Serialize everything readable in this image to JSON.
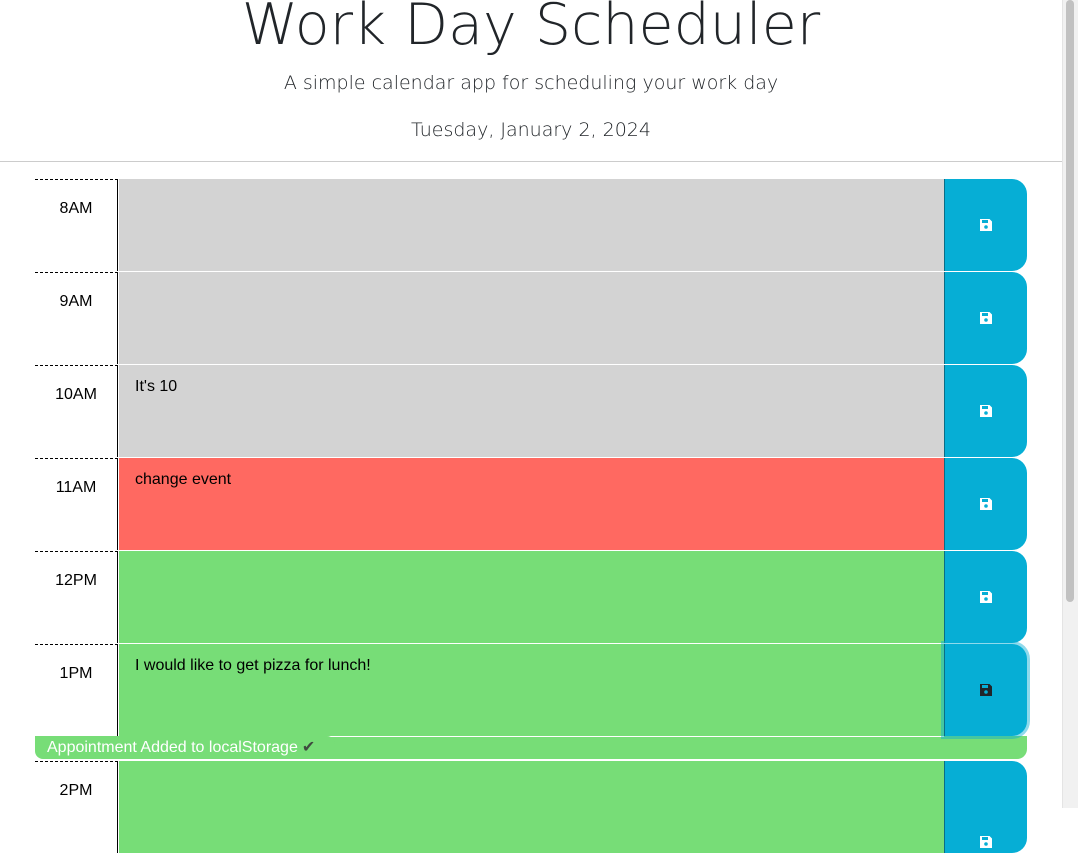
{
  "header": {
    "title": "Work Day Scheduler",
    "subtitle": "A simple calendar app for scheduling your work day",
    "current_day": "Tuesday, January 2, 2024"
  },
  "timeblocks": [
    {
      "hour": "8AM",
      "text": "",
      "state": "past"
    },
    {
      "hour": "9AM",
      "text": "",
      "state": "past"
    },
    {
      "hour": "10AM",
      "text": "It's 10",
      "state": "past"
    },
    {
      "hour": "11AM",
      "text": "change event",
      "state": "present"
    },
    {
      "hour": "12PM",
      "text": "",
      "state": "future"
    },
    {
      "hour": "1PM",
      "text": "I would like to get pizza for lunch!",
      "state": "future"
    },
    {
      "hour": "2PM",
      "text": "",
      "state": "future"
    }
  ],
  "save_button": {
    "icon": "floppy-disk-icon",
    "color": "#06aed5"
  },
  "toast": {
    "message": "Appointment Added to localStorage",
    "check": "✔"
  },
  "colors": {
    "past": "#d3d3d3",
    "present": "#ff6961",
    "future": "#77dd77"
  }
}
